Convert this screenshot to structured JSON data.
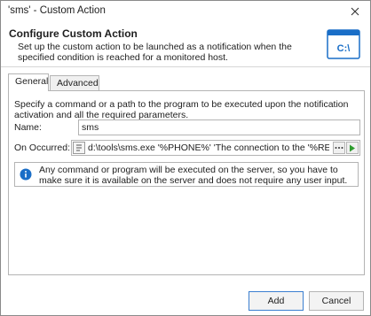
{
  "window": {
    "title": "'sms' - Custom Action"
  },
  "header": {
    "title": "Configure Custom Action",
    "description": "Set up the custom action to be launched as a notification when the specified condition is reached for a monitored host.",
    "icon_text": "C:\\"
  },
  "tabs": [
    {
      "label": "General",
      "active": true
    },
    {
      "label": "Advanced",
      "active": false
    }
  ],
  "general": {
    "description": "Specify a command or a path to the program to be executed upon the notification activation and all the required parameters.",
    "name_label": "Name:",
    "name_value": "sms",
    "on_occurred_label": "On Occurred:",
    "command_value": "d:\\tools\\sms.exe '%PHONE%' 'The connection to the '%REMOTE_HOST%'",
    "info_text": "Any command or program will be executed on the server, so you have to make sure it is available on the server and does not require any user input."
  },
  "footer": {
    "add_label": "Add",
    "cancel_label": "Cancel"
  },
  "colors": {
    "accent": "#1a6ec7",
    "run_green": "#2e9c2e"
  }
}
